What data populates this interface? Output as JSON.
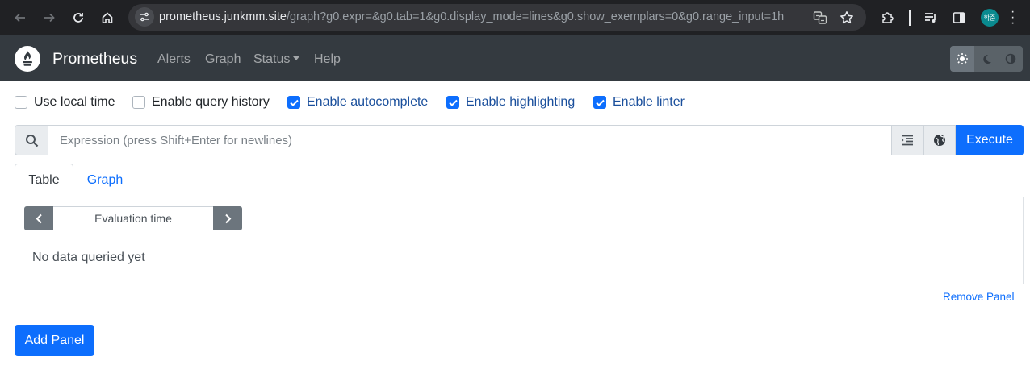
{
  "browser": {
    "url_host": "prometheus.junkmm.site",
    "url_path": "/graph?g0.expr=&g0.tab=1&g0.display_mode=lines&g0.show_exemplars=0&g0.range_input=1h",
    "profile_initials": "학준"
  },
  "navbar": {
    "brand": "Prometheus",
    "links": [
      "Alerts",
      "Graph",
      "Status",
      "Help"
    ]
  },
  "options": [
    {
      "label": "Use local time",
      "checked": false
    },
    {
      "label": "Enable query history",
      "checked": false
    },
    {
      "label": "Enable autocomplete",
      "checked": true
    },
    {
      "label": "Enable highlighting",
      "checked": true
    },
    {
      "label": "Enable linter",
      "checked": true
    }
  ],
  "expression": {
    "placeholder": "Expression (press Shift+Enter for newlines)",
    "value": "",
    "execute_label": "Execute"
  },
  "tabs": [
    "Table",
    "Graph"
  ],
  "panel": {
    "eval_time_placeholder": "Evaluation time",
    "no_data": "No data queried yet",
    "remove_label": "Remove Panel"
  },
  "add_panel_label": "Add Panel",
  "colors": {
    "primary": "#0d6efd",
    "navbar": "#343a40",
    "browser_chrome": "#202124"
  }
}
